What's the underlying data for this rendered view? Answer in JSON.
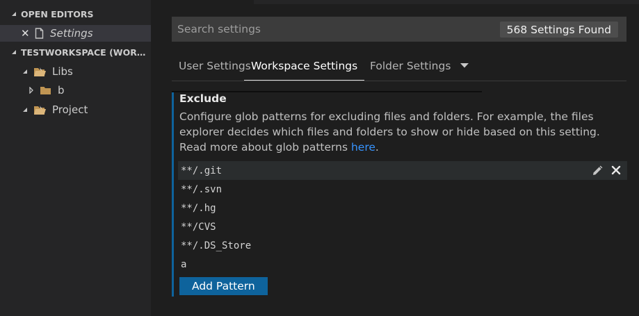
{
  "sidebar": {
    "open_editors_header": "OPEN EDITORS",
    "open_editors": [
      {
        "name": "Settings",
        "close_glyph": "✕"
      }
    ],
    "workspace_header": "TESTWORKSPACE (WORKS...",
    "tree": [
      {
        "label": "Libs",
        "expanded": true
      },
      {
        "label": "b",
        "expanded": false
      },
      {
        "label": "Project",
        "expanded": true
      }
    ]
  },
  "search": {
    "placeholder": "Search settings",
    "results_count": "568 Settings Found"
  },
  "tabs": {
    "user": "User Settings",
    "workspace": "Workspace Settings",
    "folder": "Folder Settings",
    "active": "workspace"
  },
  "exclude_setting": {
    "title": "Exclude",
    "description_prefix": "Configure glob patterns for excluding files and folders. For example, the files explorer decides which files and folders to show or hide based on this setting. Read more about glob patterns ",
    "link_text": "here",
    "description_suffix": ".",
    "patterns": [
      "**/.git",
      "**/.svn",
      "**/.hg",
      "**/CVS",
      "**/.DS_Store",
      "a"
    ],
    "add_button_label": "Add Pattern"
  },
  "colors": {
    "accent": "#0e639c",
    "link": "#3794ff",
    "sidebar_bg": "#252526",
    "editor_bg": "#1e1e1e"
  },
  "icons": {
    "open_editor_file": "file-icon",
    "folder": "folder-icon",
    "edit": "pencil-icon",
    "remove": "close-icon"
  }
}
